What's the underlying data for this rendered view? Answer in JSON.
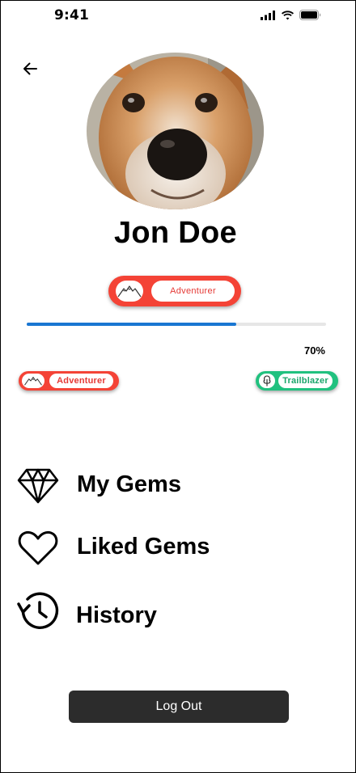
{
  "status_bar": {
    "time": "9:41",
    "icons": [
      "cellular-signal-icon",
      "wifi-icon",
      "battery-icon"
    ]
  },
  "header": {
    "back_icon": "arrow-left-icon"
  },
  "profile": {
    "name": "Jon Doe",
    "avatar": "dog-photo"
  },
  "rank": {
    "current_title": "Adventurer",
    "current_icon": "mountains-icon",
    "progress_percent": 70,
    "progress_label": "70%",
    "current_badge_label": "Adventurer",
    "next_badge_label": "Trailblazer",
    "next_icon": "tree-icon"
  },
  "colors": {
    "adventurer": "#f44336",
    "trailblazer": "#21c17f",
    "progress": "#1976d2",
    "logout_bg": "#2c2c2c"
  },
  "menu": {
    "items": [
      {
        "label": "My Gems",
        "icon": "diamond-icon"
      },
      {
        "label": "Liked Gems",
        "icon": "heart-icon"
      },
      {
        "label": "History",
        "icon": "history-icon"
      }
    ]
  },
  "actions": {
    "logout_label": "Log Out"
  }
}
